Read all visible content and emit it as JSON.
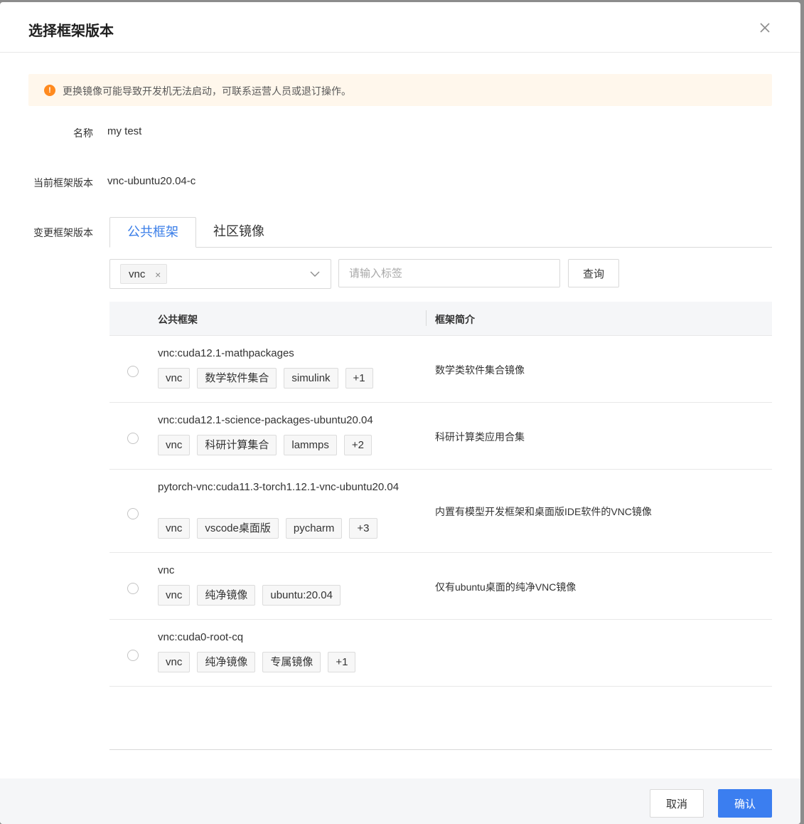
{
  "dialog": {
    "title": "选择框架版本",
    "close_icon": "close-icon"
  },
  "alert": {
    "text": "更换镜像可能导致开发机无法启动，可联系运营人员或退订操作。",
    "icon": "warning-icon",
    "icon_glyph": "!",
    "color": "#ff8a1f"
  },
  "form": {
    "name_label": "名称",
    "name_value": "my test",
    "current_label": "当前框架版本",
    "current_value": "vnc-ubuntu20.04-c",
    "change_label": "变更框架版本"
  },
  "tabs": [
    {
      "label": "公共框架",
      "active": true
    },
    {
      "label": "社区镜像",
      "active": false
    }
  ],
  "filter": {
    "selected_chip": "vnc",
    "chip_remove": "×",
    "tag_placeholder": "请输入标签",
    "query_label": "查询"
  },
  "table": {
    "columns": [
      "公共框架",
      "框架简介"
    ],
    "rows": [
      {
        "name": "vnc:cuda12.1-mathpackages",
        "tags": [
          "vnc",
          "数学软件集合",
          "simulink",
          "+1"
        ],
        "desc": "数学类软件集合镜像"
      },
      {
        "name": "vnc:cuda12.1-science-packages-ubuntu20.04",
        "tags": [
          "vnc",
          "科研计算集合",
          "lammps",
          "+2"
        ],
        "desc": "科研计算类应用合集"
      },
      {
        "name": "pytorch-vnc:cuda11.3-torch1.12.1-vnc-ubuntu20.04",
        "tags": [
          "vnc",
          "vscode桌面版",
          "pycharm",
          "+3"
        ],
        "desc": "内置有模型开发框架和桌面版IDE软件的VNC镜像"
      },
      {
        "name": "vnc",
        "tags": [
          "vnc",
          "纯净镜像",
          "ubuntu:20.04"
        ],
        "desc": "仅有ubuntu桌面的纯净VNC镜像"
      },
      {
        "name": "vnc:cuda0-root-cq",
        "tags": [
          "vnc",
          "纯净镜像",
          "专属镜像",
          "+1"
        ],
        "desc": ""
      }
    ]
  },
  "footer": {
    "cancel_label": "取消",
    "ok_label": "确认"
  },
  "colors": {
    "accent": "#3b7ef0",
    "warning": "#ff8a1f",
    "alert_bg": "#fff7ec"
  }
}
